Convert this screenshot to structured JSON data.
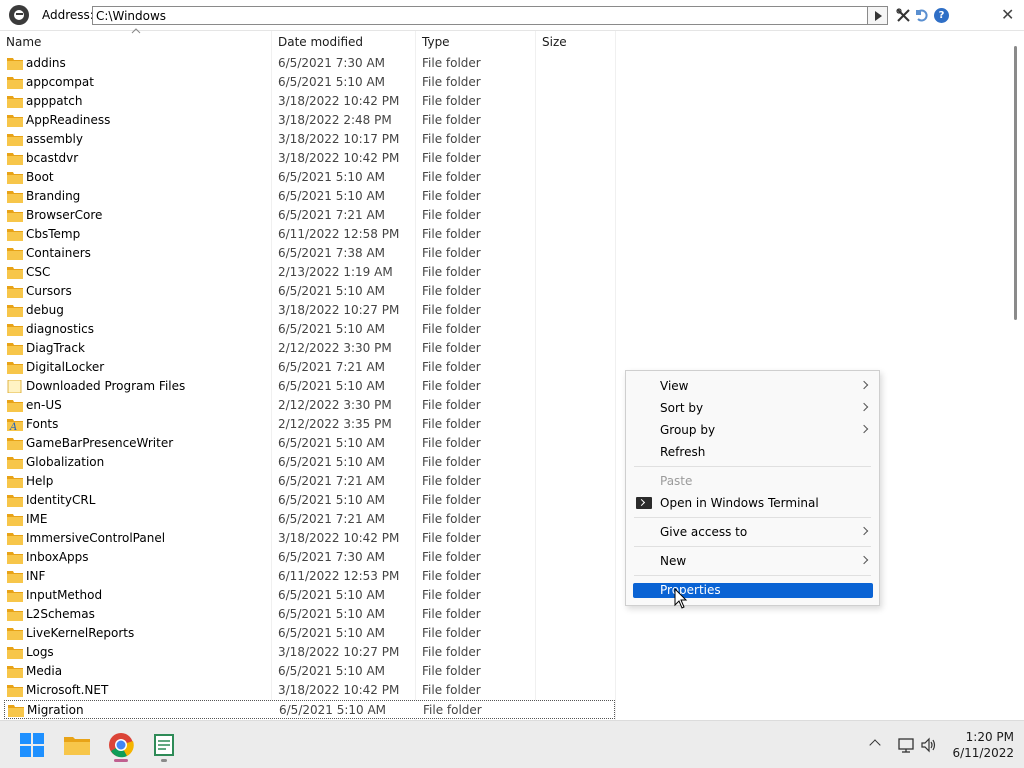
{
  "address": {
    "label": "Address:",
    "value": "C:\\Windows"
  },
  "columns": {
    "name": "Name",
    "date": "Date modified",
    "type": "Type",
    "size": "Size"
  },
  "files": [
    {
      "name": "addins",
      "date": "6/5/2021 7:30 AM",
      "type": "File folder",
      "icon": "folder-icon"
    },
    {
      "name": "appcompat",
      "date": "6/5/2021 5:10 AM",
      "type": "File folder",
      "icon": "folder-icon"
    },
    {
      "name": "apppatch",
      "date": "3/18/2022 10:42 PM",
      "type": "File folder",
      "icon": "folder-icon"
    },
    {
      "name": "AppReadiness",
      "date": "3/18/2022 2:48 PM",
      "type": "File folder",
      "icon": "folder-icon"
    },
    {
      "name": "assembly",
      "date": "3/18/2022 10:17 PM",
      "type": "File folder",
      "icon": "folder-icon"
    },
    {
      "name": "bcastdvr",
      "date": "3/18/2022 10:42 PM",
      "type": "File folder",
      "icon": "folder-icon"
    },
    {
      "name": "Boot",
      "date": "6/5/2021 5:10 AM",
      "type": "File folder",
      "icon": "folder-icon"
    },
    {
      "name": "Branding",
      "date": "6/5/2021 5:10 AM",
      "type": "File folder",
      "icon": "folder-icon"
    },
    {
      "name": "BrowserCore",
      "date": "6/5/2021 7:21 AM",
      "type": "File folder",
      "icon": "folder-icon"
    },
    {
      "name": "CbsTemp",
      "date": "6/11/2022 12:58 PM",
      "type": "File folder",
      "icon": "folder-icon"
    },
    {
      "name": "Containers",
      "date": "6/5/2021 7:38 AM",
      "type": "File folder",
      "icon": "folder-icon"
    },
    {
      "name": "CSC",
      "date": "2/13/2022 1:19 AM",
      "type": "File folder",
      "icon": "folder-icon"
    },
    {
      "name": "Cursors",
      "date": "6/5/2021 5:10 AM",
      "type": "File folder",
      "icon": "folder-icon"
    },
    {
      "name": "debug",
      "date": "3/18/2022 10:27 PM",
      "type": "File folder",
      "icon": "folder-icon"
    },
    {
      "name": "diagnostics",
      "date": "6/5/2021 5:10 AM",
      "type": "File folder",
      "icon": "folder-icon"
    },
    {
      "name": "DiagTrack",
      "date": "2/12/2022 3:30 PM",
      "type": "File folder",
      "icon": "folder-icon"
    },
    {
      "name": "DigitalLocker",
      "date": "6/5/2021 7:21 AM",
      "type": "File folder",
      "icon": "folder-icon"
    },
    {
      "name": "Downloaded Program Files",
      "date": "6/5/2021 5:10 AM",
      "type": "File folder",
      "icon": "folder-doc-icon"
    },
    {
      "name": "en-US",
      "date": "2/12/2022 3:30 PM",
      "type": "File folder",
      "icon": "folder-icon"
    },
    {
      "name": "Fonts",
      "date": "2/12/2022 3:35 PM",
      "type": "File folder",
      "icon": "fonts-folder-icon"
    },
    {
      "name": "GameBarPresenceWriter",
      "date": "6/5/2021 5:10 AM",
      "type": "File folder",
      "icon": "folder-icon"
    },
    {
      "name": "Globalization",
      "date": "6/5/2021 5:10 AM",
      "type": "File folder",
      "icon": "folder-icon"
    },
    {
      "name": "Help",
      "date": "6/5/2021 7:21 AM",
      "type": "File folder",
      "icon": "folder-icon"
    },
    {
      "name": "IdentityCRL",
      "date": "6/5/2021 5:10 AM",
      "type": "File folder",
      "icon": "folder-icon"
    },
    {
      "name": "IME",
      "date": "6/5/2021 7:21 AM",
      "type": "File folder",
      "icon": "folder-icon"
    },
    {
      "name": "ImmersiveControlPanel",
      "date": "3/18/2022 10:42 PM",
      "type": "File folder",
      "icon": "folder-icon"
    },
    {
      "name": "InboxApps",
      "date": "6/5/2021 7:30 AM",
      "type": "File folder",
      "icon": "folder-icon"
    },
    {
      "name": "INF",
      "date": "6/11/2022 12:53 PM",
      "type": "File folder",
      "icon": "folder-icon"
    },
    {
      "name": "InputMethod",
      "date": "6/5/2021 5:10 AM",
      "type": "File folder",
      "icon": "folder-icon"
    },
    {
      "name": "L2Schemas",
      "date": "6/5/2021 5:10 AM",
      "type": "File folder",
      "icon": "folder-icon"
    },
    {
      "name": "LiveKernelReports",
      "date": "6/5/2021 5:10 AM",
      "type": "File folder",
      "icon": "folder-icon"
    },
    {
      "name": "Logs",
      "date": "3/18/2022 10:27 PM",
      "type": "File folder",
      "icon": "folder-icon"
    },
    {
      "name": "Media",
      "date": "6/5/2021 5:10 AM",
      "type": "File folder",
      "icon": "folder-icon"
    },
    {
      "name": "Microsoft.NET",
      "date": "3/18/2022 10:42 PM",
      "type": "File folder",
      "icon": "folder-icon"
    },
    {
      "name": "Migration",
      "date": "6/5/2021 5:10 AM",
      "type": "File folder",
      "icon": "folder-icon",
      "selected": true
    }
  ],
  "context_menu": {
    "view": "View",
    "sort_by": "Sort by",
    "group_by": "Group by",
    "refresh": "Refresh",
    "paste": "Paste",
    "open_terminal": "Open in Windows Terminal",
    "give_access": "Give access to",
    "new": "New",
    "properties": "Properties"
  },
  "clock": {
    "time": "1:20 PM",
    "date": "6/11/2022"
  },
  "colors": {
    "accent": "#0a63d4",
    "folder": "#f7c64a",
    "taskbar": "#ececec"
  }
}
